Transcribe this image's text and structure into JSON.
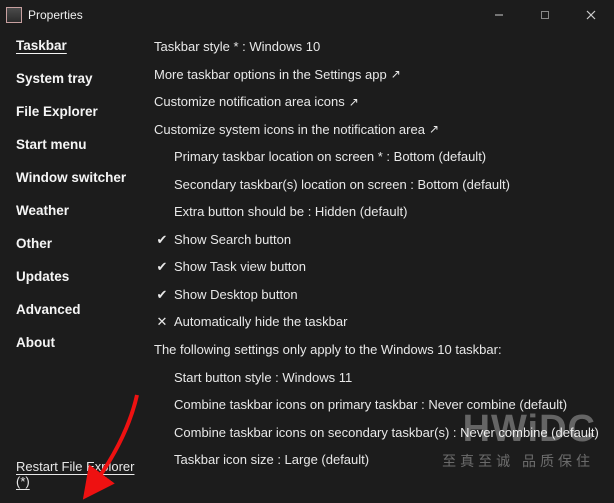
{
  "window": {
    "title": "Properties"
  },
  "sidebar": {
    "items": [
      {
        "label": "Taskbar",
        "active": true
      },
      {
        "label": "System tray",
        "active": false
      },
      {
        "label": "File Explorer",
        "active": false
      },
      {
        "label": "Start menu",
        "active": false
      },
      {
        "label": "Window switcher",
        "active": false
      },
      {
        "label": "Weather",
        "active": false
      },
      {
        "label": "Other",
        "active": false
      },
      {
        "label": "Updates",
        "active": false
      },
      {
        "label": "Advanced",
        "active": false
      },
      {
        "label": "About",
        "active": false
      }
    ],
    "restart_label": "Restart File Explorer (*)"
  },
  "content": {
    "rows": [
      {
        "indent": 0,
        "icon": "",
        "text": "Taskbar style * : Windows 10"
      },
      {
        "indent": 0,
        "icon": "link",
        "text": "More taskbar options in the Settings app"
      },
      {
        "indent": 0,
        "icon": "link",
        "text": "Customize notification area icons"
      },
      {
        "indent": 0,
        "icon": "link",
        "text": "Customize system icons in the notification area"
      },
      {
        "indent": 1,
        "icon": "",
        "text": "Primary taskbar location on screen * : Bottom (default)"
      },
      {
        "indent": 1,
        "icon": "",
        "text": "Secondary taskbar(s) location on screen : Bottom (default)"
      },
      {
        "indent": 1,
        "icon": "",
        "text": "Extra button should be : Hidden (default)"
      },
      {
        "indent": 0,
        "icon": "check",
        "text": "Show Search button"
      },
      {
        "indent": 0,
        "icon": "check",
        "text": "Show Task view button"
      },
      {
        "indent": 0,
        "icon": "check",
        "text": "Show Desktop button"
      },
      {
        "indent": 0,
        "icon": "cross",
        "text": "Automatically hide the taskbar"
      },
      {
        "indent": 0,
        "icon": "",
        "text": "The following settings only apply to the Windows 10 taskbar:"
      },
      {
        "indent": 2,
        "icon": "",
        "text": "Start button style : Windows 11"
      },
      {
        "indent": 2,
        "icon": "",
        "text": "Combine taskbar icons on primary taskbar : Never combine (default)"
      },
      {
        "indent": 2,
        "icon": "",
        "text": "Combine taskbar icons on secondary taskbar(s) : Never combine (default)"
      },
      {
        "indent": 2,
        "icon": "",
        "text": "Taskbar icon size : Large (default)"
      }
    ]
  },
  "watermark": {
    "big": "HWiDC",
    "small": "至真至诚 品质保住"
  },
  "icons": {
    "check": "✔",
    "cross": "✕",
    "link": "↗"
  }
}
